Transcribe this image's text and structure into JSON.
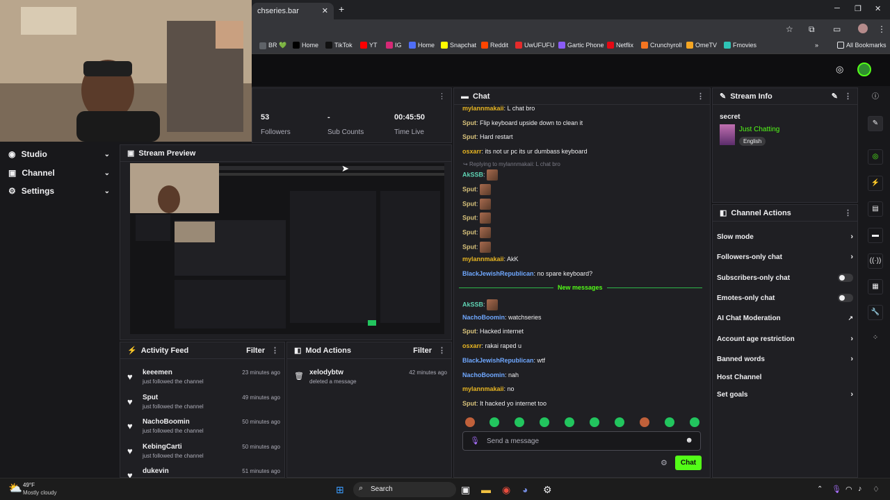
{
  "browser": {
    "tab_title": "chseries.bar",
    "new_tab": "+",
    "bookmarks": [
      {
        "label": "BR 💚",
        "icon": "browser-icon",
        "color": "#5f6368"
      },
      {
        "label": "Home",
        "icon": "x-icon",
        "color": "#000000"
      },
      {
        "label": "TikTok",
        "icon": "tiktok-icon",
        "color": "#111111"
      },
      {
        "label": "YT",
        "icon": "youtube-icon",
        "color": "#ff0000"
      },
      {
        "label": "IG",
        "icon": "instagram-icon",
        "color": "#d62976"
      },
      {
        "label": "Home",
        "icon": "home-icon",
        "color": "#4f6ef7"
      },
      {
        "label": "Snapchat",
        "icon": "snapchat-icon",
        "color": "#fffc00"
      },
      {
        "label": "Reddit",
        "icon": "reddit-icon",
        "color": "#ff4500"
      },
      {
        "label": "UwUFUFU",
        "icon": "u-icon",
        "color": "#e52b2b"
      },
      {
        "label": "Gartic Phone",
        "icon": "gartic-icon",
        "color": "#8a5cf6"
      },
      {
        "label": "Netflix",
        "icon": "netflix-icon",
        "color": "#e50914"
      },
      {
        "label": "Crunchyroll",
        "icon": "crunchyroll-icon",
        "color": "#f47521"
      },
      {
        "label": "OmeTV",
        "icon": "ometv-icon",
        "color": "#f5a623"
      },
      {
        "label": "Fmovies",
        "icon": "fmovies-icon",
        "color": "#2ec4b6"
      }
    ],
    "all_bookmarks": "All Bookmarks"
  },
  "leftnav": {
    "items": [
      {
        "label": "Studio"
      },
      {
        "label": "Channel"
      },
      {
        "label": "Settings"
      }
    ]
  },
  "stats": {
    "followers_value": "53",
    "followers_label": "Followers",
    "subs_value": "-",
    "subs_label": "Sub Counts",
    "time_value": "00:45:50",
    "time_label": "Time Live"
  },
  "stream_preview": {
    "title": "Stream Preview"
  },
  "activity": {
    "title": "Activity Feed",
    "filter": "Filter",
    "items": [
      {
        "name": "keeemen",
        "sub": "just followed the channel",
        "time": "23 minutes ago"
      },
      {
        "name": "Sput",
        "sub": "just followed the channel",
        "time": "49 minutes ago"
      },
      {
        "name": "NachoBoomin",
        "sub": "just followed the channel",
        "time": "50 minutes ago"
      },
      {
        "name": "KebingCarti",
        "sub": "just followed the channel",
        "time": "50 minutes ago"
      },
      {
        "name": "dukevin",
        "sub": "",
        "time": "51 minutes ago"
      }
    ]
  },
  "mod": {
    "title": "Mod Actions",
    "filter": "Filter",
    "item_name": "xelodybtw",
    "item_sub": "deleted a message",
    "item_time": "42 minutes ago"
  },
  "chat": {
    "title": "Chat",
    "new_messages": "New messages",
    "reply_note": "Replying to mylannmakaii: L chat bro",
    "lines": [
      {
        "user": "mylannmakaii",
        "color": "#e6b422",
        "text": ": L chat bro"
      },
      {
        "user": "Sput",
        "color": "#d6c07a",
        "text": ": Flip keyboard upside down to clean it"
      },
      {
        "user": "Sput",
        "color": "#d6c07a",
        "text": ": Hard restart"
      },
      {
        "user": "osxarr",
        "color": "#e6b422",
        "text": ": its not ur pc its ur dumbass keyboard"
      },
      {
        "user": "AkSSB",
        "color": "#5fd3b4",
        "text": ":"
      },
      {
        "user": "Sput",
        "color": "#d6c07a",
        "text": ":"
      },
      {
        "user": "Sput",
        "color": "#d6c07a",
        "text": ":"
      },
      {
        "user": "Sput",
        "color": "#d6c07a",
        "text": ":"
      },
      {
        "user": "Sput",
        "color": "#d6c07a",
        "text": ":"
      },
      {
        "user": "Sput",
        "color": "#d6c07a",
        "text": ":"
      },
      {
        "user": "mylannmakaii",
        "color": "#e6b422",
        "text": ": AkK"
      },
      {
        "user": "BlackJewishRepublican",
        "color": "#6fa8ff",
        "text": ": no spare keyboard?"
      },
      {
        "user": "AkSSB",
        "color": "#5fd3b4",
        "text": ":"
      },
      {
        "user": "NachoBoomin",
        "color": "#6fa8ff",
        "text": ": watchseries"
      },
      {
        "user": "Sput",
        "color": "#d6c07a",
        "text": ": Hacked internet"
      },
      {
        "user": "osxarr",
        "color": "#e6b422",
        "text": ": rakai raped u"
      },
      {
        "user": "BlackJewishRepublican",
        "color": "#6fa8ff",
        "text": ": wtf"
      },
      {
        "user": "NachoBoomin",
        "color": "#6fa8ff",
        "text": ": nah"
      },
      {
        "user": "mylannmakaii",
        "color": "#e6b422",
        "text": ": no"
      },
      {
        "user": "Sput",
        "color": "#d6c07a",
        "text": ": It hacked yo internet too"
      }
    ],
    "placeholder": "Send a message",
    "send": "Chat"
  },
  "stream_info": {
    "title": "Stream Info",
    "stream_title": "secret",
    "category": "Just Chatting",
    "tag": "English"
  },
  "channel_actions": {
    "title": "Channel Actions",
    "items": [
      {
        "label": "Slow mode",
        "control": "arrow"
      },
      {
        "label": "Followers-only chat",
        "control": "arrow"
      },
      {
        "label": "Subscribers-only chat",
        "control": "toggle"
      },
      {
        "label": "Emotes-only chat",
        "control": "toggle"
      },
      {
        "label": "AI Chat Moderation",
        "control": "external"
      },
      {
        "label": "Account age restriction",
        "control": "arrow"
      },
      {
        "label": "Banned words",
        "control": "arrow"
      },
      {
        "label": "Host Channel",
        "control": "none"
      },
      {
        "label": "Set goals",
        "control": "arrow"
      }
    ]
  },
  "taskbar": {
    "weather_temp": "49°F",
    "weather_desc": "Mostly cloudy",
    "search": "Search"
  },
  "colors": {
    "accent": "#53fc18",
    "bg": "#18181b",
    "panel": "#1f1f23"
  }
}
